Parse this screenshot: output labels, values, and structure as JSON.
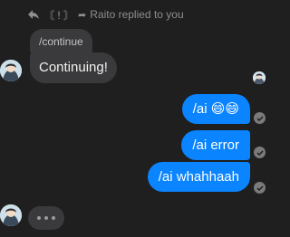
{
  "reply_header": {
    "bracket_text": "〘 ! 〙",
    "forward_symbol": "➦",
    "text": "Raito replied to you"
  },
  "quoted_message": {
    "text": "/continue"
  },
  "incoming_message": {
    "text": "Continuing!"
  },
  "outgoing_messages": [
    {
      "text": "/ai 😄😄"
    },
    {
      "text": "/ai error"
    },
    {
      "text": "/ai whahhaah"
    }
  ],
  "colors": {
    "background": "#1f1f1f",
    "incoming_bubble": "#3a3a3c",
    "outgoing_bubble": "#0a84ff",
    "muted_text": "#8e8e8e"
  },
  "icons": {
    "reply": "reply-arrow-icon",
    "seen": "check-circle-icon",
    "typing": "typing-dots-icon"
  }
}
